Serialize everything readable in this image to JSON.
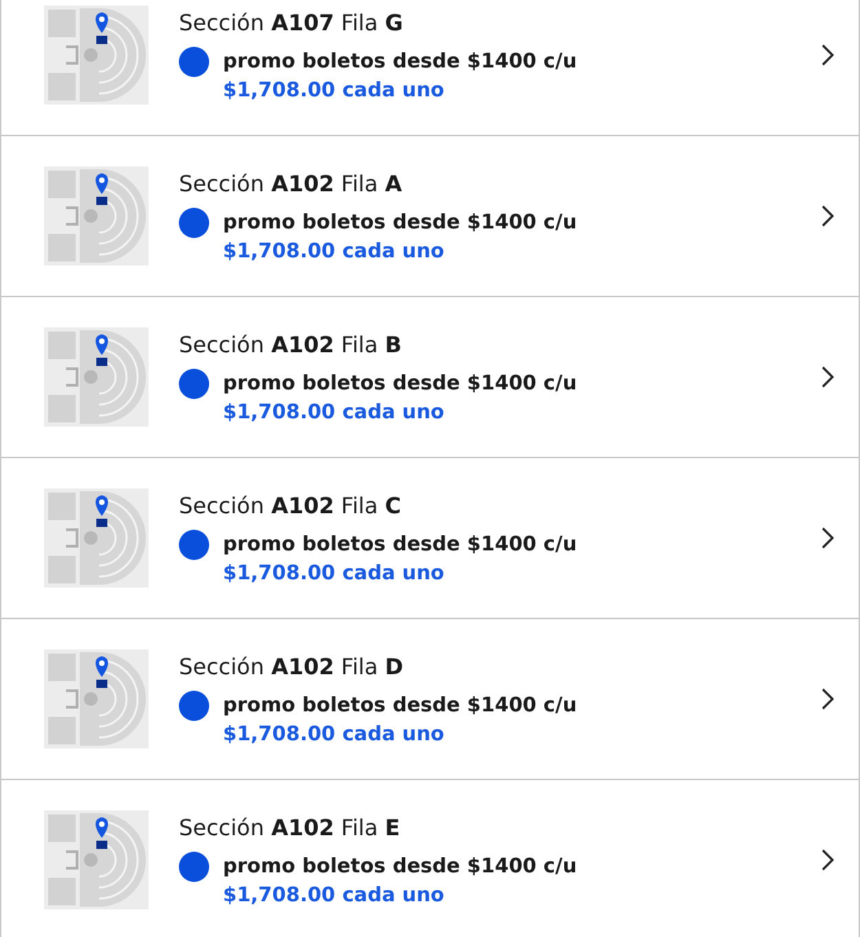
{
  "listings": [
    {
      "title": "Sección **A107**  Fila **G**",
      "promo": "promo boletos desde $1400 c/u",
      "price": "$1,708.00 cada uno",
      "color": "#0a4fdc"
    },
    {
      "title": "Sección **A102**  Fila **A**",
      "promo": "promo boletos desde $1400 c/u",
      "price": "$1,708.00 cada uno",
      "color": "#0a4fdc"
    },
    {
      "title": "Sección **A102**  Fila **B**",
      "promo": "promo boletos desde $1400 c/u",
      "price": "$1,708.00 cada uno",
      "color": "#0a4fdc"
    },
    {
      "title": "Sección **A102**  Fila **C**",
      "promo": "promo boletos desde $1400 c/u",
      "price": "$1,708.00 cada uno",
      "color": "#0a4fdc"
    },
    {
      "title": "Sección **A102**  Fila **D**",
      "promo": "promo boletos desde $1400 c/u",
      "price": "$1,708.00 cada uno",
      "color": "#0a4fdc"
    },
    {
      "title": "Sección **A102**  Fila **E**",
      "promo": "promo boletos desde $1400 c/u",
      "price": "$1,708.00 cada uno",
      "color": "#0a4fdc"
    }
  ]
}
